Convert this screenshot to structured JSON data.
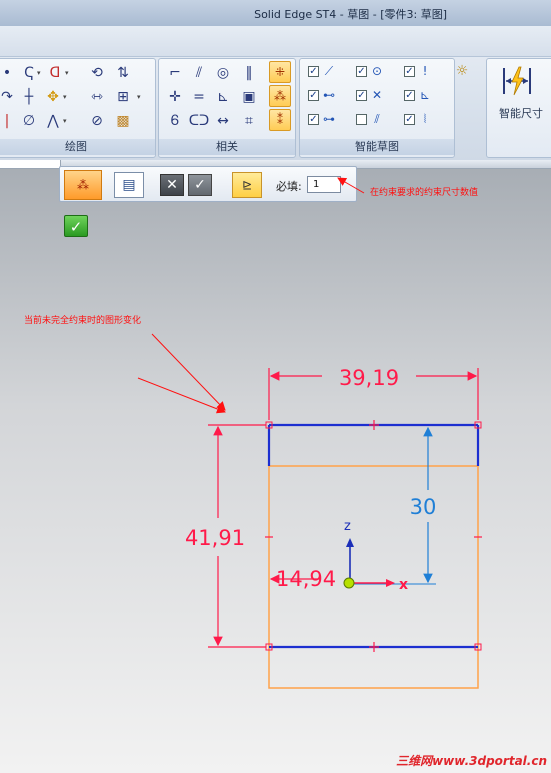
{
  "window": {
    "title": "Solid Edge ST4 - 草图 - [零件3: 草图]"
  },
  "ribbon": {
    "groups": {
      "draw": {
        "label": "绘图"
      },
      "relate": {
        "label": "相关"
      },
      "intellisketch": {
        "label": "智能草图"
      },
      "smartdim": {
        "label": "智能尺寸"
      }
    }
  },
  "command_bar": {
    "required_label": "必填:",
    "required_value": "1"
  },
  "annotations": {
    "required_note": "在约束要求的约束尺寸数值",
    "shape_note": "当前未完全约束时的图形变化"
  },
  "sketch": {
    "dims": {
      "width": "39,19",
      "height": "41,91",
      "inner": "30",
      "offset": "14,94"
    },
    "axes": {
      "z": "z",
      "x": "x"
    }
  },
  "watermark": "三维网www.3dportal.cn",
  "colors": {
    "dimension": "#ff1a4a",
    "profile": "#1c2fd0",
    "construction": "#ffa24a",
    "driving_dim": "#1f7fd6"
  }
}
